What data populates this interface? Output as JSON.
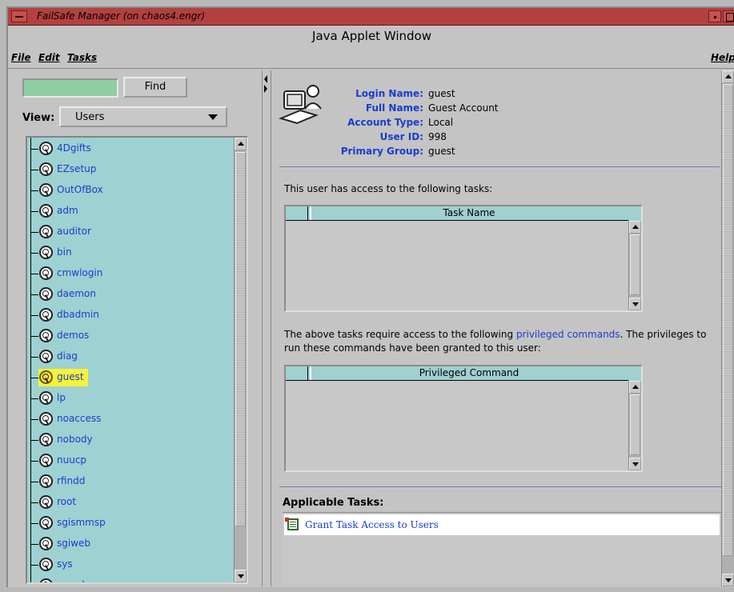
{
  "window": {
    "title": "FailSafe Manager (on chaos4.engr)",
    "applet_title": "Java Applet Window",
    "title_bar_color": "#b44040"
  },
  "menubar": {
    "file": "File",
    "edit": "Edit",
    "tasks": "Tasks",
    "help": "Help"
  },
  "left": {
    "search_value": "",
    "find_label": "Find",
    "view_label": "View:",
    "view_selected": "Users",
    "tree_bg_color": "#9ed1d1",
    "selected_highlight_color": "#f6f23a",
    "items": [
      {
        "label": "4Dgifts"
      },
      {
        "label": "EZsetup"
      },
      {
        "label": "OutOfBox"
      },
      {
        "label": "adm"
      },
      {
        "label": "auditor"
      },
      {
        "label": "bin"
      },
      {
        "label": "cmwlogin"
      },
      {
        "label": "daemon"
      },
      {
        "label": "dbadmin"
      },
      {
        "label": "demos"
      },
      {
        "label": "diag"
      },
      {
        "label": "guest",
        "selected": true
      },
      {
        "label": "lp"
      },
      {
        "label": "noaccess"
      },
      {
        "label": "nobody"
      },
      {
        "label": "nuucp"
      },
      {
        "label": "rfindd"
      },
      {
        "label": "root"
      },
      {
        "label": "sgismmsp"
      },
      {
        "label": "sgiweb"
      },
      {
        "label": "sys"
      },
      {
        "label": "sysadm"
      }
    ]
  },
  "user": {
    "login_name_key": "Login Name:",
    "login_name": "guest",
    "full_name_key": "Full Name:",
    "full_name": "Guest Account",
    "account_type_key": "Account Type:",
    "account_type": "Local",
    "user_id_key": "User ID:",
    "user_id": "998",
    "primary_group_key": "Primary Group:",
    "primary_group": "guest"
  },
  "access": {
    "intro": "This user has access to the following tasks:",
    "task_table_header": "Task Name",
    "task_rows": [],
    "priv_text_1": "The above tasks require access to the following ",
    "priv_link": "privileged commands",
    "priv_text_2": ".  The privileges to",
    "priv_text_3": "run these commands have been granted to this user:",
    "priv_table_header": "Privileged Command",
    "priv_rows": []
  },
  "applicable": {
    "title": "Applicable Tasks:",
    "tasks": [
      "Grant Task Access to Users"
    ]
  },
  "colors": {
    "link_blue": "#1a3ccf",
    "table_header": "#a0d0d0"
  }
}
